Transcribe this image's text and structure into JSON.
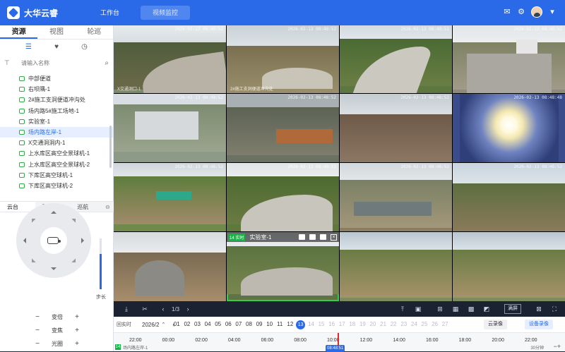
{
  "app": {
    "title": "大华云睿"
  },
  "nav": {
    "tab1": "工作台",
    "tab2": "视频监控"
  },
  "left": {
    "tabs": [
      "资源",
      "视图",
      "轮巡"
    ],
    "search_placeholder": "请输入名称",
    "tree": [
      "中部便道",
      "右坝隅-1",
      "2#施工支洞便道冲沟处",
      "场内路5#施工场地-1",
      "实验室-1",
      "场内路左岸-1",
      "X交通洞洞内-1",
      "上水库区高空全景球机-1",
      "上水库区高空全景球机-2",
      "下库区高空球机-1",
      "下库区高空球机-2"
    ],
    "selected_index": 5
  },
  "ptz": {
    "tabs": [
      "云台",
      "预置点",
      "巡航"
    ],
    "speed_label": "步长",
    "speed_level": 0.7,
    "controls": [
      "变倍",
      "变焦",
      "光圈"
    ]
  },
  "grid": {
    "tiles": [
      {
        "ts": "2026-02-13 08:48:52",
        "cn": "X交通洞口-1"
      },
      {
        "ts": "2026-02-13 08:48:52",
        "cn": "2#施工支洞便道冲沟处"
      },
      {
        "ts": "2026-02-13 08:48:51",
        "cn": ""
      },
      {
        "ts": "2026-02-13 08:48:52",
        "cn": ""
      },
      {
        "ts": "2026-02-13 08:48:52",
        "cn": ""
      },
      {
        "ts": "2026-02-13 08:48:52",
        "cn": ""
      },
      {
        "ts": "2026-02-13 08:48:52",
        "cn": ""
      },
      {
        "ts": "2026-02-13 08:48:48",
        "cn": ""
      },
      {
        "ts": "2026-02-13 08:48:52",
        "cn": ""
      },
      {
        "ts": "2026-02-13 08:48:52",
        "cn": ""
      },
      {
        "ts": "2026-02-13 08:48:52",
        "cn": ""
      },
      {
        "ts": "2026-02-13 08:48:52",
        "cn": ""
      },
      {
        "ts": "",
        "cn": ""
      },
      {
        "ts": "",
        "cn": ""
      },
      {
        "ts": "",
        "cn": ""
      },
      {
        "ts": "",
        "cn": ""
      }
    ],
    "active_tile": {
      "badge": "14 实时",
      "name": "实验室-1"
    }
  },
  "toolbar": {
    "page": "1/3",
    "split_label": "满屏"
  },
  "timeline": {
    "mode": "回实时",
    "month": "2026/2",
    "days": [
      "01",
      "02",
      "03",
      "04",
      "05",
      "06",
      "07",
      "08",
      "09",
      "10",
      "11",
      "12",
      "13",
      "14",
      "15",
      "16",
      "17",
      "18",
      "19",
      "20",
      "21",
      "22",
      "23",
      "24",
      "25",
      "26",
      "27"
    ],
    "current_day": "13",
    "cloud_label": "云录像",
    "device_label": "设备录像",
    "camera_index": "14",
    "camera_name": "场内路左岸-1",
    "ticks": [
      "22:00",
      "00:00",
      "02:00",
      "04:00",
      "06:00",
      "08:00",
      "10:00",
      "12:00",
      "14:00",
      "16:00",
      "18:00",
      "20:00",
      "22:00"
    ],
    "cursor_time": "08:48:51",
    "scale": "30分钟"
  },
  "colors": {
    "brand": "#2a6ae8",
    "live": "#15b545",
    "cursor": "#e0282e"
  }
}
